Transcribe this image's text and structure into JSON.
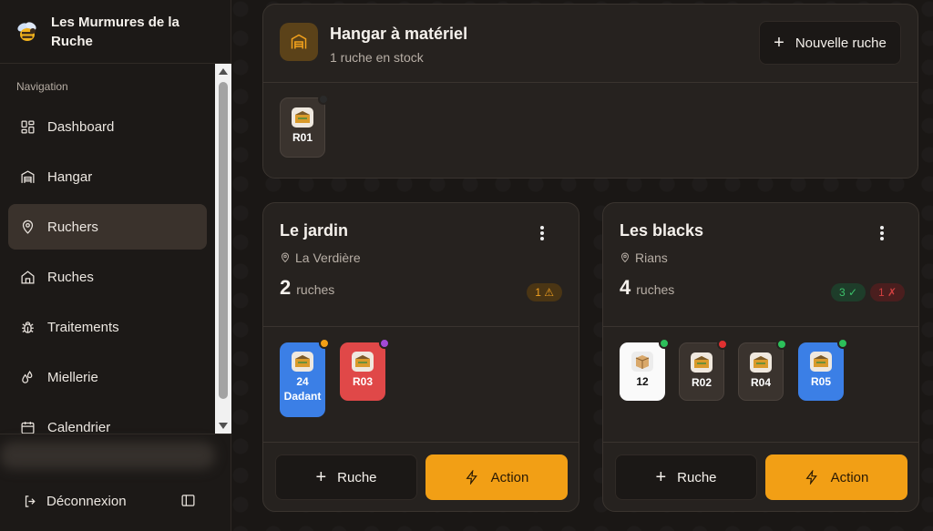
{
  "app": {
    "title": "Les Murmures de la Ruche",
    "logo_icon": "bee-logo-icon"
  },
  "sidebar": {
    "heading": "Navigation",
    "items": [
      {
        "label": "Dashboard",
        "icon": "dashboard-icon",
        "active": false
      },
      {
        "label": "Hangar",
        "icon": "warehouse-icon",
        "active": false
      },
      {
        "label": "Ruchers",
        "icon": "map-pin-icon",
        "active": true
      },
      {
        "label": "Ruches",
        "icon": "home-icon",
        "active": false
      },
      {
        "label": "Traitements",
        "icon": "bug-icon",
        "active": false
      },
      {
        "label": "Miellerie",
        "icon": "droplets-icon",
        "active": false
      },
      {
        "label": "Calendrier",
        "icon": "calendar-icon",
        "active": false
      }
    ],
    "logout_label": "Déconnexion"
  },
  "hangar": {
    "title": "Hangar à matériel",
    "subtitle": "1 ruche en stock",
    "new_button": "Nouvelle ruche",
    "hives": [
      {
        "label": "R01",
        "style": "dark",
        "status": "#2a2a2a"
      }
    ]
  },
  "apiaries": [
    {
      "name": "Le jardin",
      "location": "La Verdière",
      "count": "2",
      "count_label": "ruches",
      "badges": [
        {
          "text": "1 ⚠",
          "type": "warn"
        }
      ],
      "hives": [
        {
          "label": "24\nDadant",
          "line1": "24",
          "line2": "Dadant",
          "style": "blue",
          "status": "#f29f15"
        },
        {
          "label": "R03",
          "line1": "R03",
          "line2": "",
          "style": "red",
          "status": "#a349d6"
        }
      ],
      "buttons": {
        "add": "Ruche",
        "action": "Action"
      }
    },
    {
      "name": "Les blacks",
      "location": "Rians",
      "count": "4",
      "count_label": "ruches",
      "badges": [
        {
          "text": "3 ✓",
          "type": "ok"
        },
        {
          "text": "1 ✗",
          "type": "ko"
        }
      ],
      "hives": [
        {
          "line1": "12",
          "line2": "",
          "style": "white",
          "status": "#2cc05a"
        },
        {
          "line1": "R02",
          "line2": "",
          "style": "dark",
          "status": "#e03030"
        },
        {
          "line1": "R04",
          "line2": "",
          "style": "dark",
          "status": "#2cc05a"
        },
        {
          "line1": "R05",
          "line2": "",
          "style": "blue",
          "status": "#2cc05a"
        }
      ],
      "buttons": {
        "add": "Ruche",
        "action": "Action"
      }
    }
  ],
  "colors": {
    "accent": "#f29f15",
    "background": "#1a1715",
    "card": "#26221f"
  }
}
